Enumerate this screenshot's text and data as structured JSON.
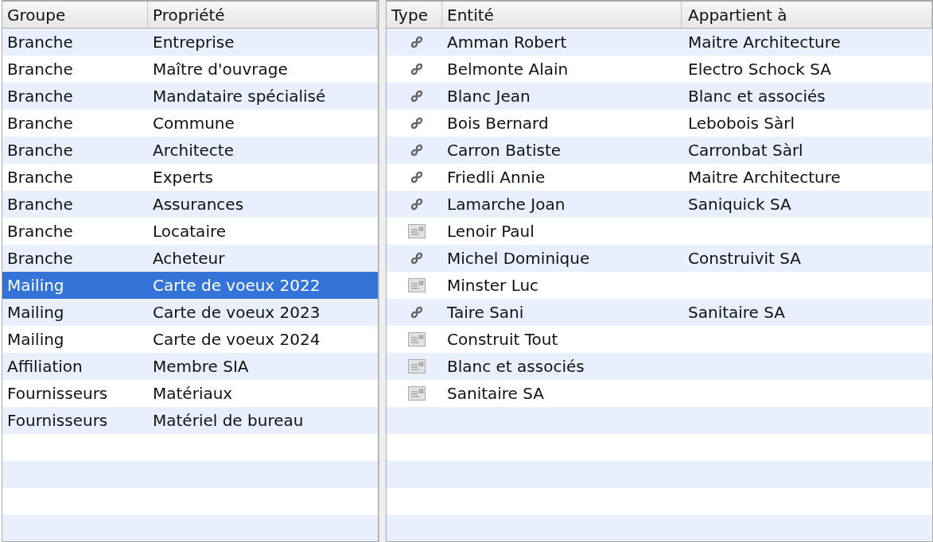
{
  "left_table": {
    "columns": [
      "Groupe",
      "Propriété"
    ],
    "rows": [
      {
        "group": "Branche",
        "property": "Entreprise",
        "selected": false
      },
      {
        "group": "Branche",
        "property": "Maître d'ouvrage",
        "selected": false
      },
      {
        "group": "Branche",
        "property": "Mandataire spécialisé",
        "selected": false
      },
      {
        "group": "Branche",
        "property": "Commune",
        "selected": false
      },
      {
        "group": "Branche",
        "property": "Architecte",
        "selected": false
      },
      {
        "group": "Branche",
        "property": "Experts",
        "selected": false
      },
      {
        "group": "Branche",
        "property": "Assurances",
        "selected": false
      },
      {
        "group": "Branche",
        "property": "Locataire",
        "selected": false
      },
      {
        "group": "Branche",
        "property": "Acheteur",
        "selected": false
      },
      {
        "group": "Mailing",
        "property": "Carte de voeux 2022",
        "selected": true
      },
      {
        "group": "Mailing",
        "property": "Carte de voeux 2023",
        "selected": false
      },
      {
        "group": "Mailing",
        "property": "Carte de voeux 2024",
        "selected": false
      },
      {
        "group": "Affiliation",
        "property": "Membre SIA",
        "selected": false
      },
      {
        "group": "Fournisseurs",
        "property": "Matériaux",
        "selected": false
      },
      {
        "group": "Fournisseurs",
        "property": "Matériel de bureau",
        "selected": false
      }
    ]
  },
  "right_table": {
    "columns": [
      "Type",
      "Entité",
      "Appartient à"
    ],
    "rows": [
      {
        "kind": "link",
        "entity": "Amman Robert",
        "belongs_to": "Maitre Architecture"
      },
      {
        "kind": "link",
        "entity": "Belmonte Alain",
        "belongs_to": "Electro Schock SA"
      },
      {
        "kind": "link",
        "entity": "Blanc Jean",
        "belongs_to": "Blanc et associés"
      },
      {
        "kind": "link",
        "entity": "Bois Bernard",
        "belongs_to": "Lebobois Sàrl"
      },
      {
        "kind": "link",
        "entity": "Carron Batiste",
        "belongs_to": "Carronbat Sàrl"
      },
      {
        "kind": "link",
        "entity": "Friedli Annie",
        "belongs_to": "Maitre Architecture"
      },
      {
        "kind": "link",
        "entity": "Lamarche Joan",
        "belongs_to": "Saniquick SA"
      },
      {
        "kind": "card",
        "entity": "Lenoir Paul"
      },
      {
        "kind": "link",
        "entity": "Michel Dominique",
        "belongs_to": "Construivit SA"
      },
      {
        "kind": "card",
        "entity": "Minster Luc"
      },
      {
        "kind": "link",
        "entity": "Taire Sani",
        "belongs_to": "Sanitaire SA"
      },
      {
        "kind": "card",
        "entity": "Construit Tout"
      },
      {
        "kind": "card",
        "entity": "Blanc et associés"
      },
      {
        "kind": "card",
        "entity": "Sanitaire SA"
      }
    ]
  }
}
